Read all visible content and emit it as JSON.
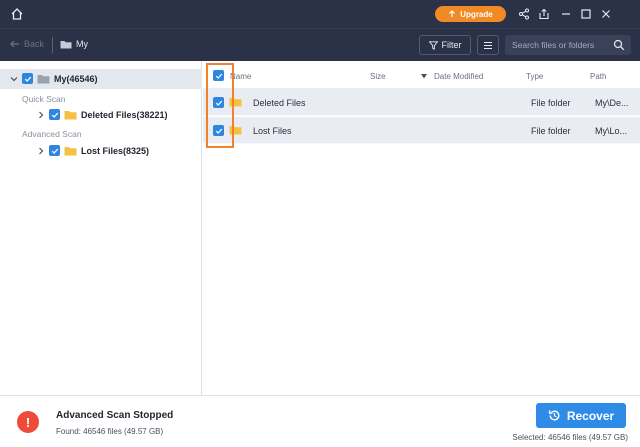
{
  "titlebar": {
    "upgrade_label": "Upgrade",
    "accent_color": "#f08a24"
  },
  "navbar": {
    "back_label": "Back",
    "breadcrumb": "My",
    "filter_label": "Filter",
    "search_placeholder": "Search files or folders"
  },
  "tree": {
    "root_label": "My(46546)",
    "quick_scan_label": "Quick Scan",
    "deleted_files_label": "Deleted Files(38221)",
    "advanced_scan_label": "Advanced Scan",
    "lost_files_label": "Lost Files(8325)"
  },
  "list": {
    "columns": {
      "name": "Name",
      "size": "Size",
      "date_modified": "Date Modified",
      "type": "Type",
      "path": "Path"
    },
    "rows": [
      {
        "name": "Deleted Files",
        "size": "",
        "date_modified": "",
        "type": "File folder",
        "path": "My\\De..."
      },
      {
        "name": "Lost Files",
        "size": "",
        "date_modified": "",
        "type": "File folder",
        "path": "My\\Lo..."
      }
    ]
  },
  "status": {
    "title": "Advanced Scan Stopped",
    "found_text": "Found: 46546 files (49.57 GB)",
    "recover_label": "Recover",
    "selected_text": "Selected: 46546 files (49.57 GB)"
  },
  "icons": {
    "home": "home-icon",
    "share": "share-icon",
    "export": "export-icon",
    "minimize": "minimize-icon",
    "maximize": "maximize-icon",
    "close": "close-icon",
    "back": "arrow-left-icon",
    "folder": "folder-icon",
    "filter": "filter-icon",
    "menu": "hamburger-icon",
    "search": "search-icon",
    "alert": "alert-icon",
    "recover": "recover-icon"
  }
}
